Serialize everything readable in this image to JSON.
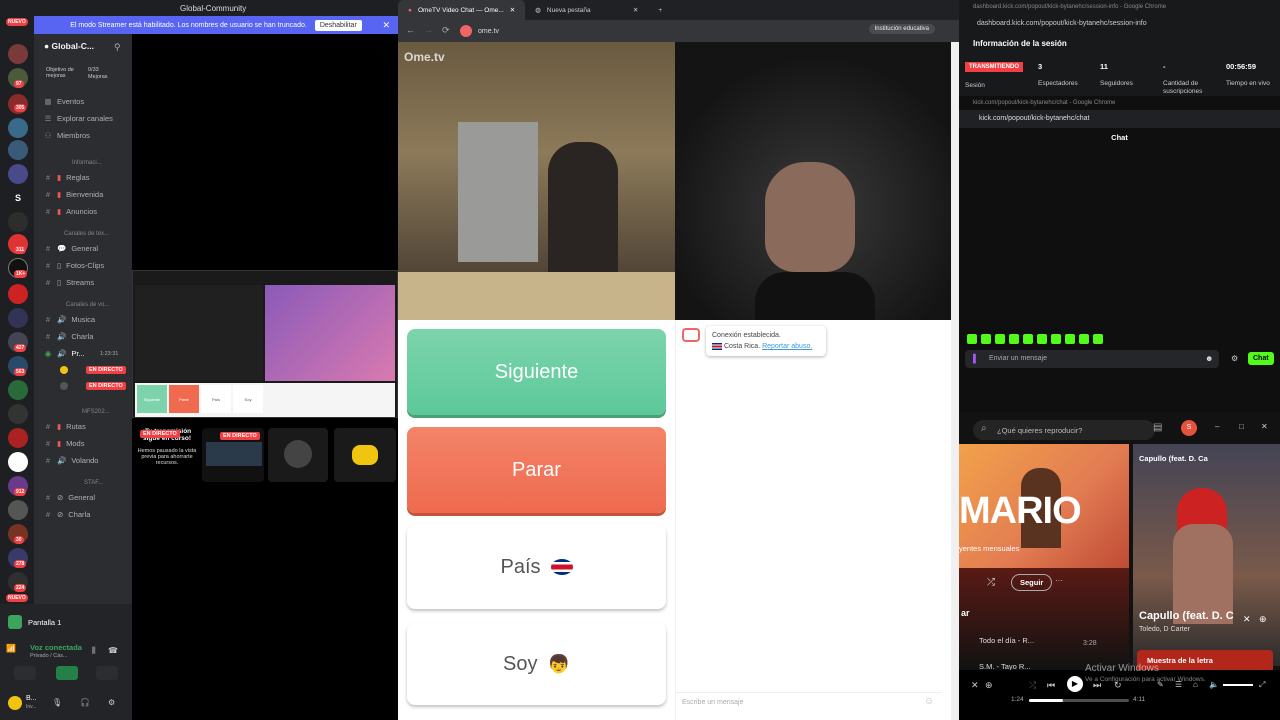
{
  "discord": {
    "title": "Global-Community",
    "banner_text": "El modo Streamer está habilitado. Los nombres de usuario se han truncado.",
    "banner_button": "Deshabilitar",
    "server_name": "Global-C...",
    "boost_label": "Objetivo de mejoras",
    "boost_count": "0/33",
    "boost_sub": "Mejoras",
    "menu": [
      "Eventos",
      "Explorar canales",
      "Miembros"
    ],
    "cat_info": "Informaci...",
    "info_channels": [
      "Reglas",
      "Bienvenida",
      "Anuncios"
    ],
    "cat_text": "Canales de tex...",
    "text_channels": [
      "General",
      "Fotos-Clips",
      "Streams"
    ],
    "cat_voice": "Canales de vo...",
    "voice_channels": [
      "Musica",
      "Charla",
      "Pr..."
    ],
    "voice_timer": "1:23:31",
    "live_label": "EN DIRECTO",
    "cat_mfs": "MFS202...",
    "mfs_channels": [
      "Rutas",
      "Mods",
      "Volando"
    ],
    "cat_staff": "STAF...",
    "staff_channels": [
      "General",
      "Charla"
    ],
    "screen_label": "Pantalla 1",
    "voice_connected": "Voz conectada",
    "voice_sub": "Privado / Cás...",
    "user_name": "B...",
    "user_status": "Inv..."
  },
  "servers": {
    "badges": [
      "17",
      "97",
      "305",
      "86",
      "311",
      "1K+",
      "427",
      "563",
      "30",
      "278",
      "224",
      "912"
    ],
    "new1": "NUEVO",
    "new2": "NUEVO",
    "letter": "S"
  },
  "preview": {
    "pause_title": "¡Tu transmisión sigue en curso!",
    "pause_text": "Hemos pausado la vista previa para ahorrarte recursos.",
    "live": "EN DIRECTO",
    "live2": "EN DIRECTO",
    "mini_siguiente": "Siguiente",
    "mini_parar": "Parar",
    "mini_pais": "País",
    "mini_soy": "Soy"
  },
  "ome": {
    "tab1": "OmeTV Video Chat — Ome...",
    "tab2": "Nueva pestaña",
    "url": "ome.tv",
    "edu": "Institución educativa",
    "logo": "Ome.tv",
    "btn_next": "Siguiente",
    "btn_stop": "Parar",
    "btn_country": "País",
    "btn_me": "Soy",
    "chat_connected": "Conexión establecida.",
    "chat_country": "Costa Rica.",
    "chat_report": "Reportar abuso.",
    "chat_placeholder": "Escribe un mensaje"
  },
  "kick": {
    "url1": "dashboard.kick.com/popout/kick-bytanehc/session-info",
    "win1": "dashboard.kick.com/popout/kick-bytanehc/session-info - Google Chrome",
    "section": "Información de la sesión",
    "status": "TRANSMITIENDO",
    "status_sub": "Sesión",
    "stats": [
      {
        "v": "3",
        "l": "Espectadores"
      },
      {
        "v": "11",
        "l": "Seguidores"
      },
      {
        "v": "-",
        "l": "Cantidad de suscripciones"
      },
      {
        "v": "00:56:59",
        "l": "Tiempo en vivo"
      }
    ],
    "win2": "kick.com/popout/kick-bytanehc/chat - Google Chrome",
    "url2": "kick.com/popout/kick-bytanehc/chat",
    "chat_title": "Chat",
    "chat_placeholder": "Enviar un mensaje",
    "chat_button": "Chat"
  },
  "spotify": {
    "search": "¿Qué quieres reproducir?",
    "avatar": "S",
    "artist_big": "MARIO",
    "listeners": "yentes mensuales",
    "follow": "Seguir",
    "more": "···",
    "section_letter": "ar",
    "track1": "Todo el día - R...",
    "track1_time": "3:28",
    "track2": "S.M. - Tayo R...",
    "np_title_small": "Capullo (feat. D. Ca",
    "np_title": "Capullo (feat. D. C",
    "np_artist": "Toledo, D Carter",
    "lyrics": "Muestra de la letra",
    "time_now": "1:24",
    "time_total": "4:11",
    "watermark1": "Activar Windows",
    "watermark2": "Ve a Configuración para activar Windows."
  },
  "colors": {
    "siguiente": "#5cc99a",
    "parar": "#ef6a4f",
    "live": "#f23f43",
    "kick_green": "#53fc18",
    "discord_blurple": "#5865f2"
  }
}
